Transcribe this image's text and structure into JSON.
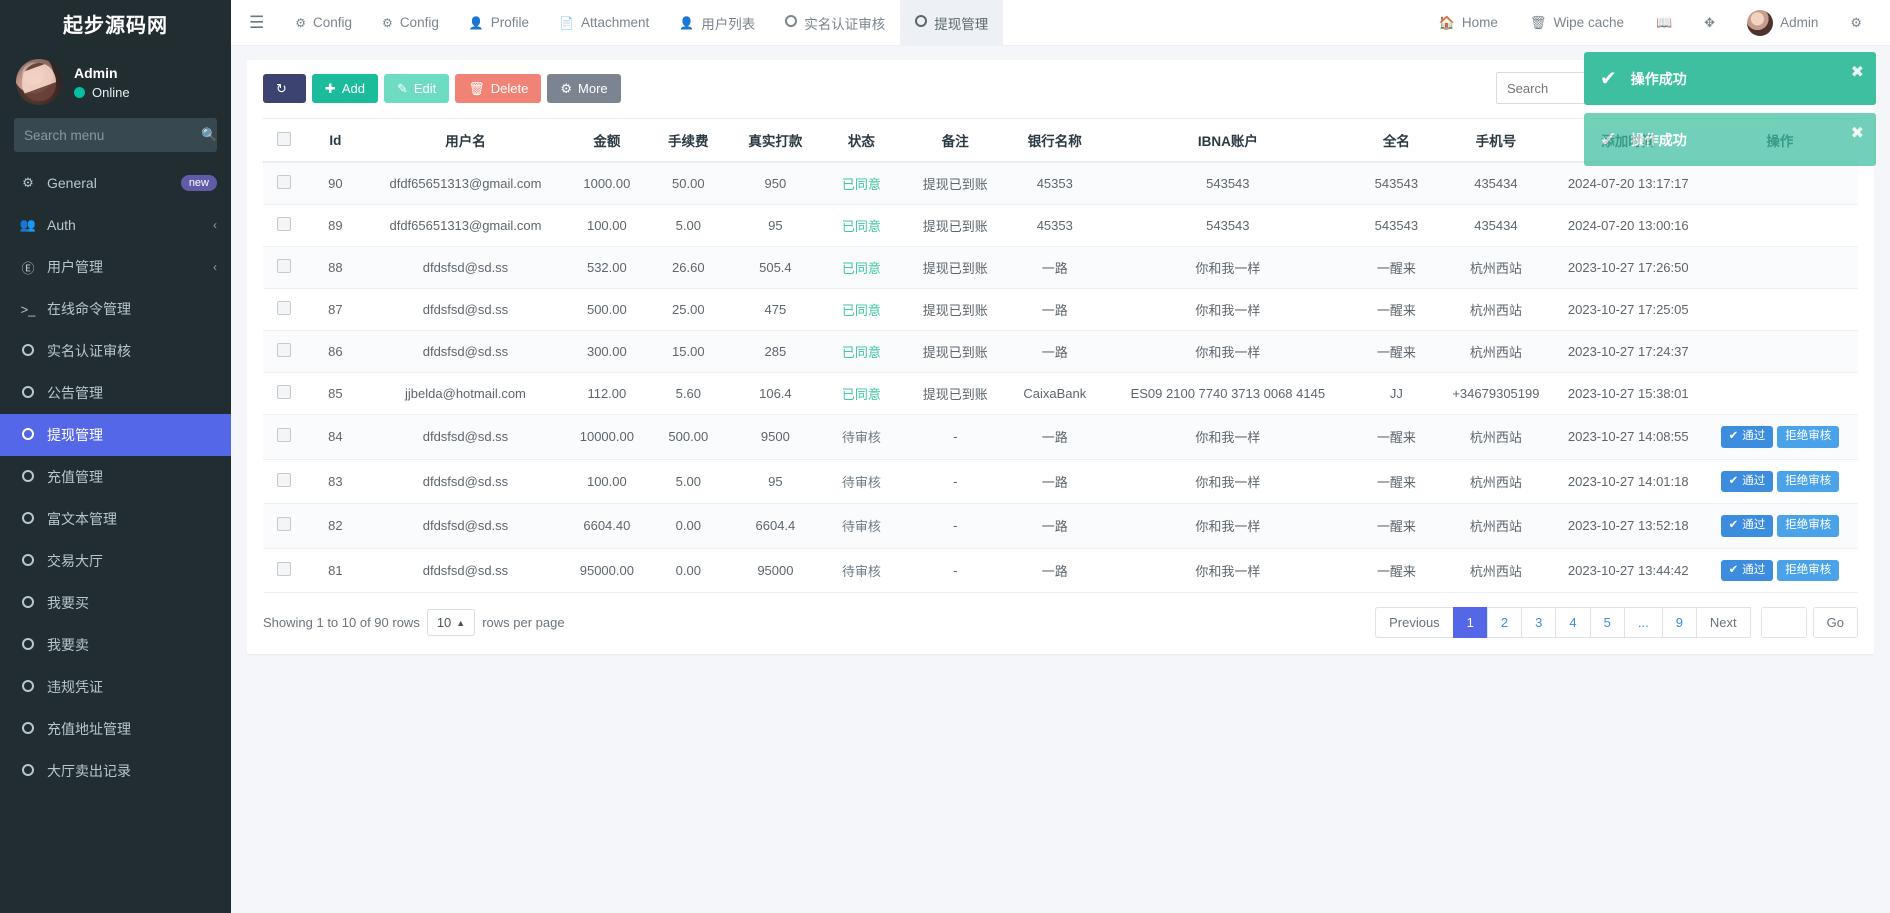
{
  "sidebar": {
    "brand": "起步源码网",
    "user": {
      "name": "Admin",
      "status": "Online"
    },
    "search_placeholder": "Search menu",
    "items": [
      {
        "label": "General",
        "icon": "cogs-icon",
        "badge": "new",
        "active": false,
        "chev": false
      },
      {
        "label": "Auth",
        "icon": "users-icon",
        "badge": "",
        "active": false,
        "chev": true
      },
      {
        "label": "用户管理",
        "icon": "user-circle-icon",
        "badge": "",
        "active": false,
        "chev": true
      },
      {
        "label": "在线命令管理",
        "icon": "terminal-icon",
        "badge": "",
        "active": false,
        "chev": false
      },
      {
        "label": "实名认证审核",
        "icon": "circle-icon",
        "badge": "",
        "active": false,
        "chev": false
      },
      {
        "label": "公告管理",
        "icon": "circle-icon",
        "badge": "",
        "active": false,
        "chev": false
      },
      {
        "label": "提现管理",
        "icon": "circle-icon",
        "badge": "",
        "active": true,
        "chev": false
      },
      {
        "label": "充值管理",
        "icon": "circle-icon",
        "badge": "",
        "active": false,
        "chev": false
      },
      {
        "label": "富文本管理",
        "icon": "circle-icon",
        "badge": "",
        "active": false,
        "chev": false
      },
      {
        "label": "交易大厅",
        "icon": "circle-icon",
        "badge": "",
        "active": false,
        "chev": false
      },
      {
        "label": "我要买",
        "icon": "circle-icon",
        "badge": "",
        "active": false,
        "chev": false
      },
      {
        "label": "我要卖",
        "icon": "circle-icon",
        "badge": "",
        "active": false,
        "chev": false
      },
      {
        "label": "违规凭证",
        "icon": "circle-icon",
        "badge": "",
        "active": false,
        "chev": false
      },
      {
        "label": "充值地址管理",
        "icon": "circle-icon",
        "badge": "",
        "active": false,
        "chev": false
      },
      {
        "label": "大厅卖出记录",
        "icon": "circle-icon",
        "badge": "",
        "active": false,
        "chev": false
      }
    ]
  },
  "topnav": {
    "menu_icon": "hamburger-icon",
    "tabs": [
      {
        "label": "Config",
        "icon": "gear-icon",
        "active": false
      },
      {
        "label": "Config",
        "icon": "gear-icon",
        "active": false
      },
      {
        "label": "Profile",
        "icon": "user-icon",
        "active": false
      },
      {
        "label": "Attachment",
        "icon": "file-image-icon",
        "active": false
      },
      {
        "label": "用户列表",
        "icon": "user-icon",
        "active": false
      },
      {
        "label": "实名认证审核",
        "icon": "circle-icon",
        "active": false
      },
      {
        "label": "提现管理",
        "icon": "circle-icon",
        "active": true
      }
    ],
    "right": [
      {
        "label": "Home",
        "icon": "home-icon"
      },
      {
        "label": "Wipe cache",
        "icon": "trash-icon"
      },
      {
        "label": "",
        "icon": "language-icon"
      },
      {
        "label": "",
        "icon": "fullscreen-icon"
      },
      {
        "label": "Admin",
        "icon": "avatar"
      },
      {
        "label": "",
        "icon": "cogs-icon"
      }
    ]
  },
  "toolbar": {
    "refresh_label": "",
    "add_label": "Add",
    "edit_label": "Edit",
    "delete_label": "Delete",
    "more_label": "More",
    "search_placeholder": "Search",
    "icons": [
      "columns-icon",
      "grid-icon",
      "export-icon",
      "search-icon"
    ]
  },
  "toasts": [
    {
      "message": "操作成功",
      "close": "✖"
    },
    {
      "message": "操作成功",
      "close": "✖"
    }
  ],
  "table": {
    "columns": [
      "",
      "Id",
      "用户名",
      "金额",
      "手续费",
      "真实打款",
      "状态",
      "备注",
      "银行名称",
      "IBNA账户",
      "全名",
      "手机号",
      "添加时间",
      "操作"
    ],
    "action_pass": "通过",
    "action_reject": "拒绝审核",
    "rows": [
      {
        "id": "90",
        "user": "dfdf65651313@gmail.com",
        "amount": "1000.00",
        "fee": "50.00",
        "real": "950",
        "status": "已同意",
        "status_type": "ok",
        "note": "提现已到账",
        "bank": "45353",
        "iban": "543543",
        "fullname": "543543",
        "phone": "435434",
        "created": "2024-07-20 13:17:17",
        "actions": false
      },
      {
        "id": "89",
        "user": "dfdf65651313@gmail.com",
        "amount": "100.00",
        "fee": "5.00",
        "real": "95",
        "status": "已同意",
        "status_type": "ok",
        "note": "提现已到账",
        "bank": "45353",
        "iban": "543543",
        "fullname": "543543",
        "phone": "435434",
        "created": "2024-07-20 13:00:16",
        "actions": false
      },
      {
        "id": "88",
        "user": "dfdsfsd@sd.ss",
        "amount": "532.00",
        "fee": "26.60",
        "real": "505.4",
        "status": "已同意",
        "status_type": "ok",
        "note": "提现已到账",
        "bank": "一路",
        "iban": "你和我一样",
        "fullname": "一醒来",
        "phone": "杭州西站",
        "created": "2023-10-27 17:26:50",
        "actions": false
      },
      {
        "id": "87",
        "user": "dfdsfsd@sd.ss",
        "amount": "500.00",
        "fee": "25.00",
        "real": "475",
        "status": "已同意",
        "status_type": "ok",
        "note": "提现已到账",
        "bank": "一路",
        "iban": "你和我一样",
        "fullname": "一醒来",
        "phone": "杭州西站",
        "created": "2023-10-27 17:25:05",
        "actions": false
      },
      {
        "id": "86",
        "user": "dfdsfsd@sd.ss",
        "amount": "300.00",
        "fee": "15.00",
        "real": "285",
        "status": "已同意",
        "status_type": "ok",
        "note": "提现已到账",
        "bank": "一路",
        "iban": "你和我一样",
        "fullname": "一醒来",
        "phone": "杭州西站",
        "created": "2023-10-27 17:24:37",
        "actions": false
      },
      {
        "id": "85",
        "user": "jjbelda@hotmail.com",
        "amount": "112.00",
        "fee": "5.60",
        "real": "106.4",
        "status": "已同意",
        "status_type": "ok",
        "note": "提现已到账",
        "bank": "CaixaBank",
        "iban": "ES09 2100 7740 3713 0068 4145",
        "fullname": "JJ",
        "phone": "+34679305199",
        "created": "2023-10-27 15:38:01",
        "actions": false
      },
      {
        "id": "84",
        "user": "dfdsfsd@sd.ss",
        "amount": "10000.00",
        "fee": "500.00",
        "real": "9500",
        "status": "待审核",
        "status_type": "pending",
        "note": "-",
        "bank": "一路",
        "iban": "你和我一样",
        "fullname": "一醒来",
        "phone": "杭州西站",
        "created": "2023-10-27 14:08:55",
        "actions": true
      },
      {
        "id": "83",
        "user": "dfdsfsd@sd.ss",
        "amount": "100.00",
        "fee": "5.00",
        "real": "95",
        "status": "待审核",
        "status_type": "pending",
        "note": "-",
        "bank": "一路",
        "iban": "你和我一样",
        "fullname": "一醒来",
        "phone": "杭州西站",
        "created": "2023-10-27 14:01:18",
        "actions": true
      },
      {
        "id": "82",
        "user": "dfdsfsd@sd.ss",
        "amount": "6604.40",
        "fee": "0.00",
        "real": "6604.4",
        "status": "待审核",
        "status_type": "pending",
        "note": "-",
        "bank": "一路",
        "iban": "你和我一样",
        "fullname": "一醒来",
        "phone": "杭州西站",
        "created": "2023-10-27 13:52:18",
        "actions": true
      },
      {
        "id": "81",
        "user": "dfdsfsd@sd.ss",
        "amount": "95000.00",
        "fee": "0.00",
        "real": "95000",
        "status": "待审核",
        "status_type": "pending",
        "note": "-",
        "bank": "一路",
        "iban": "你和我一样",
        "fullname": "一醒来",
        "phone": "杭州西站",
        "created": "2023-10-27 13:44:42",
        "actions": true
      }
    ]
  },
  "footer": {
    "showing_prefix": "Showing 1 to 10 of 90 rows",
    "rows_per_page_value": "10",
    "rows_per_page_suffix": "rows per page",
    "previous": "Previous",
    "next": "Next",
    "pages": [
      "1",
      "2",
      "3",
      "4",
      "5",
      "...",
      "9"
    ],
    "active_page": "1",
    "goto_value": "",
    "go_label": "Go"
  },
  "colors": {
    "sidebar_bg": "#222d32",
    "accent": "#5468e7",
    "success": "#3dbfa0",
    "add": "#1bbc9b",
    "delete": "#f08276"
  }
}
